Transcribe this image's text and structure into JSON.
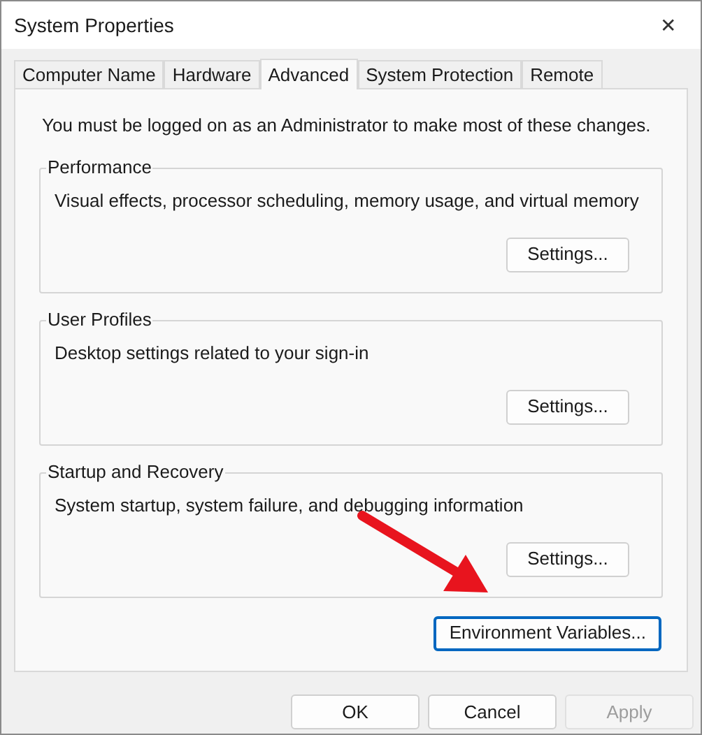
{
  "window": {
    "title": "System Properties",
    "close": "✕"
  },
  "tabs": [
    {
      "label": "Computer Name",
      "selected": false
    },
    {
      "label": "Hardware",
      "selected": false
    },
    {
      "label": "Advanced",
      "selected": true
    },
    {
      "label": "System Protection",
      "selected": false
    },
    {
      "label": "Remote",
      "selected": false
    }
  ],
  "admin_note": "You must be logged on as an Administrator to make most of these changes.",
  "groups": [
    {
      "title": "Performance",
      "description": "Visual effects, processor scheduling, memory usage, and virtual memory",
      "button": "Settings..."
    },
    {
      "title": "User Profiles",
      "description": "Desktop settings related to your sign-in",
      "button": "Settings..."
    },
    {
      "title": "Startup and Recovery",
      "description": "System startup, system failure, and debugging information",
      "button": "Settings..."
    }
  ],
  "environment_button": {
    "label": "Environment Variables...",
    "focused": true
  },
  "dialog_buttons": [
    {
      "label": "OK",
      "disabled": false
    },
    {
      "label": "Cancel",
      "disabled": false
    },
    {
      "label": "Apply",
      "disabled": true
    }
  ]
}
